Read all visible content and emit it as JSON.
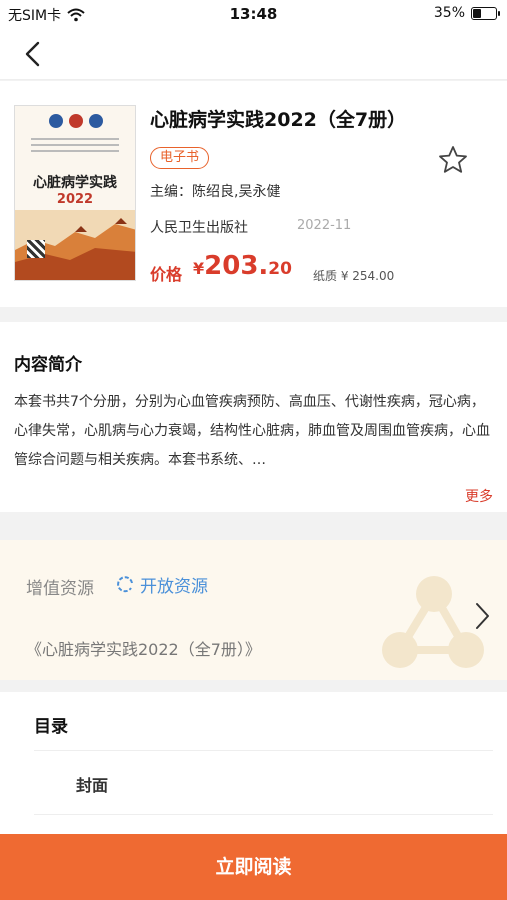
{
  "status_bar": {
    "carrier": "无SIM卡",
    "time": "13:48",
    "battery_percent": "35%",
    "battery_level": 0.35
  },
  "nav": {
    "back_icon": "chevron-left-icon"
  },
  "book": {
    "title": "心脏病学实践2022（全7册）",
    "badge": "电子书",
    "editor": "主编：陈绍良,吴永健",
    "publisher": "人民卫生出版社",
    "pub_date": "2022-11",
    "price_label": "价格",
    "price_currency": "¥",
    "price_int": "203.",
    "price_dec": "20",
    "paper_price": "纸质 ¥ 254.00",
    "cover": {
      "title": "心脏病学实践",
      "year": "2022"
    },
    "favorite_icon": "star-outline-icon"
  },
  "intro": {
    "heading": "内容简介",
    "text": "本套书共7个分册，分别为心血管疾病预防、高血压、代谢性疾病，冠心病，心律失常，心肌病与心力衰竭，结构性心脏病，肺血管及周围血管疾病，心血管综合问题与相关疾病。本套书系统、…",
    "more": "更多"
  },
  "resources": {
    "heading": "增值资源",
    "open_label": "开放资源",
    "item": "《心脏病学实践2022（全7册）》"
  },
  "toc": {
    "heading": "目录",
    "items": [
      "封面"
    ]
  },
  "action": {
    "read_label": "立即阅读"
  },
  "colors": {
    "accent": "#ef6a32",
    "price": "#d93c2b",
    "link_blue": "#4a90d9"
  }
}
